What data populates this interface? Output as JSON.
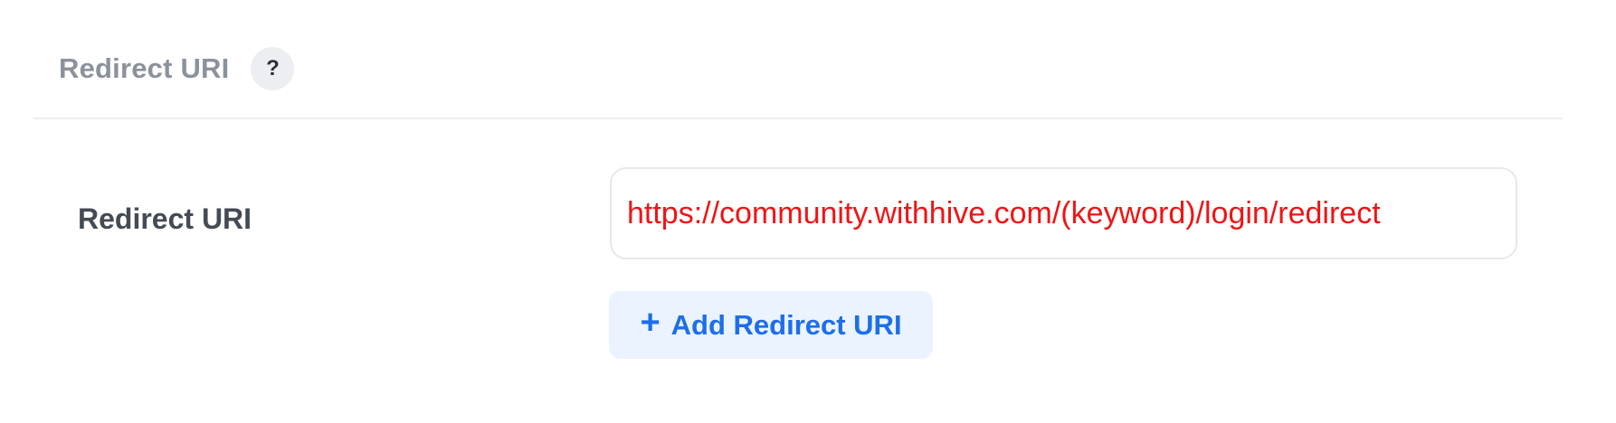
{
  "section": {
    "title": "Redirect URI",
    "help_icon": "question-mark-icon",
    "help_glyph": "?"
  },
  "form": {
    "label": "Redirect URI",
    "uri_value": "https://community.withhive.com/(keyword)/login/redirect",
    "add_button": {
      "icon": "plus-icon",
      "glyph": "+",
      "label": "Add Redirect URI"
    }
  },
  "colors": {
    "header_text": "#8b929c",
    "label_text": "#444b55",
    "uri_text": "#f01414",
    "button_bg": "#eaf3ff",
    "button_text": "#1d6ee8",
    "divider": "#eceef1"
  }
}
